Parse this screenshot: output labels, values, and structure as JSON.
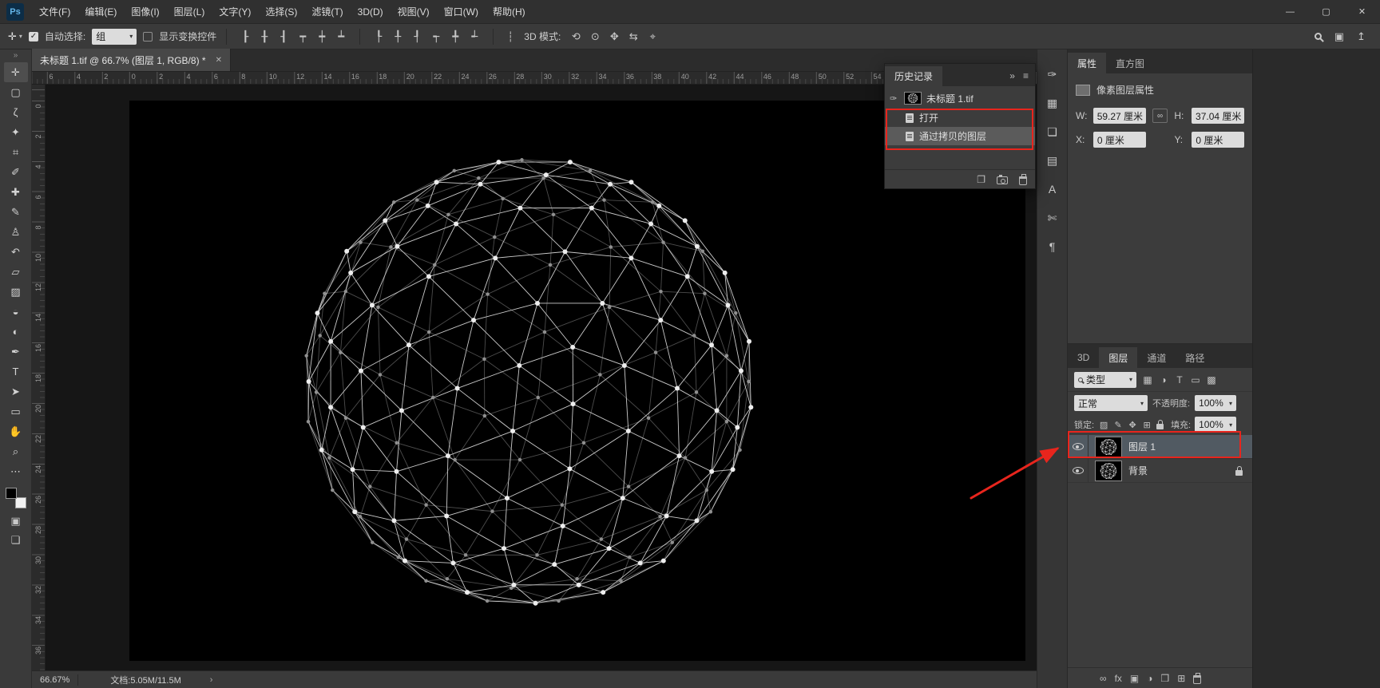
{
  "window": {
    "logo": "Ps",
    "controls": [
      {
        "name": "minimize-button",
        "glyph": "—"
      },
      {
        "name": "maximize-button",
        "glyph": "▢"
      },
      {
        "name": "close-button",
        "glyph": "✕"
      }
    ]
  },
  "menubar": {
    "items": [
      "文件(F)",
      "编辑(E)",
      "图像(I)",
      "图层(L)",
      "文字(Y)",
      "选择(S)",
      "滤镜(T)",
      "3D(D)",
      "视图(V)",
      "窗口(W)",
      "帮助(H)"
    ]
  },
  "optionsbar": {
    "active_tool_glyph": "✛",
    "auto_select_label": "自动选择:",
    "auto_select_value": "组",
    "show_transform_label": "显示变换控件",
    "mode_label": "3D 模式:",
    "align_icons": [
      {
        "name": "align-left-icon",
        "glyph": "┠"
      },
      {
        "name": "align-center-horizontal-icon",
        "glyph": "╂"
      },
      {
        "name": "align-right-icon",
        "glyph": "┨"
      },
      {
        "name": "align-top-icon",
        "glyph": "┯"
      },
      {
        "name": "align-middle-vertical-icon",
        "glyph": "┿"
      },
      {
        "name": "align-bottom-icon",
        "glyph": "┷"
      }
    ],
    "distribute_icons": [
      {
        "name": "distribute-top-icon",
        "glyph": "┞"
      },
      {
        "name": "distribute-vertical-center-icon",
        "glyph": "╀"
      },
      {
        "name": "distribute-bottom-icon",
        "glyph": "┦"
      },
      {
        "name": "distribute-left-icon",
        "glyph": "┭"
      },
      {
        "name": "distribute-horizontal-center-icon",
        "glyph": "╇"
      },
      {
        "name": "distribute-right-icon",
        "glyph": "┵"
      }
    ],
    "spacing_icon_glyph": "┆",
    "mode_icons": [
      {
        "name": "3d-orbit-icon",
        "glyph": "⟲"
      },
      {
        "name": "3d-roll-icon",
        "glyph": "⊙"
      },
      {
        "name": "3d-pan-icon",
        "glyph": "✥"
      },
      {
        "name": "3d-slide-icon",
        "glyph": "⇆"
      },
      {
        "name": "3d-zoom-icon",
        "glyph": "⌖"
      }
    ],
    "right_icons": [
      {
        "name": "workspace-icon",
        "glyph": "▣"
      },
      {
        "name": "share-icon",
        "glyph": "↥"
      }
    ]
  },
  "tools": [
    {
      "name": "move-tool",
      "glyph": "✛",
      "active": true
    },
    {
      "name": "marquee-tool",
      "glyph": "▢"
    },
    {
      "name": "lasso-tool",
      "glyph": "ζ"
    },
    {
      "name": "quick-selection-tool",
      "glyph": "✦"
    },
    {
      "name": "crop-tool",
      "glyph": "⌗"
    },
    {
      "name": "eyedropper-tool",
      "glyph": "✐"
    },
    {
      "name": "healing-brush-tool",
      "glyph": "✚"
    },
    {
      "name": "brush-tool",
      "glyph": "✎"
    },
    {
      "name": "clone-stamp-tool",
      "glyph": "♙"
    },
    {
      "name": "history-brush-tool",
      "glyph": "↶"
    },
    {
      "name": "eraser-tool",
      "glyph": "▱"
    },
    {
      "name": "gradient-tool",
      "glyph": "▨"
    },
    {
      "name": "blur-tool",
      "glyph": "◒"
    },
    {
      "name": "dodge-tool",
      "glyph": "◐"
    },
    {
      "name": "pen-tool",
      "glyph": "✒"
    },
    {
      "name": "type-tool",
      "glyph": "T"
    },
    {
      "name": "path-selection-tool",
      "glyph": "➤"
    },
    {
      "name": "shape-tool",
      "glyph": "▭"
    },
    {
      "name": "hand-tool",
      "glyph": "✋"
    },
    {
      "name": "zoom-tool",
      "glyph": "⌕"
    },
    {
      "name": "edit-toolbar-button",
      "glyph": "⋯"
    }
  ],
  "toolbar_extras": {
    "collapse_glyph": "»",
    "quick_mask_glyph": "▣",
    "screen_mode_glyph": "❏"
  },
  "document": {
    "tab_title": "未标题 1.tif @ 66.7% (图层 1, RGB/8) *",
    "close_glyph": "✕",
    "zoom_level": "66.67%",
    "doc_info": "文档:5.05M/11.5M",
    "chevron": "›"
  },
  "rulers": {
    "horizontal": [
      "6",
      "4",
      "2",
      "0",
      "2",
      "4",
      "6",
      "8",
      "10",
      "12",
      "14",
      "16",
      "18",
      "20",
      "22",
      "24",
      "26",
      "28",
      "30",
      "32",
      "34",
      "36",
      "38",
      "40",
      "42",
      "44",
      "46",
      "48",
      "50",
      "52",
      "54"
    ],
    "vertical": [
      "0",
      "2",
      "4",
      "6",
      "8",
      "10",
      "12",
      "14",
      "16",
      "18",
      "20",
      "22",
      "24",
      "26",
      "28",
      "30",
      "32",
      "34",
      "36"
    ]
  },
  "icon_dock": [
    {
      "name": "brush-settings-panel-icon",
      "glyph": "✑"
    },
    {
      "name": "swatches-panel-icon",
      "glyph": "▦"
    },
    {
      "name": "libraries-panel-icon",
      "glyph": "❏"
    },
    {
      "name": "adjustments-panel-icon",
      "glyph": "▤"
    },
    {
      "name": "character-panel-icon",
      "glyph": "A"
    },
    {
      "name": "glyphs-panel-icon",
      "glyph": "✄"
    },
    {
      "name": "paragraph-panel-icon",
      "glyph": "¶"
    }
  ],
  "history": {
    "title": "历史记录",
    "collapse_glyph": "»",
    "menu_glyph": "≡",
    "snapshot_label": "未标题 1.tif",
    "steps": [
      {
        "label": "打开"
      },
      {
        "label": "通过拷贝的图层",
        "selected": true
      }
    ]
  },
  "properties": {
    "tabs": [
      "属性",
      "直方图"
    ],
    "subtitle": "像素图层属性",
    "w_label": "W:",
    "w_value": "59.27 厘米",
    "h_label": "H:",
    "h_value": "37.04 厘米",
    "x_label": "X:",
    "x_value": "0 厘米",
    "y_label": "Y:",
    "y_value": "0 厘米"
  },
  "layers": {
    "tabs": [
      "3D",
      "图层",
      "通道",
      "路径"
    ],
    "filter_prefix": "类型",
    "filter_icons": [
      {
        "name": "filter-pixel-layers-icon",
        "glyph": "▦"
      },
      {
        "name": "filter-adjustment-layers-icon",
        "glyph": "◑"
      },
      {
        "name": "filter-type-layers-icon",
        "glyph": "T"
      },
      {
        "name": "filter-shape-layers-icon",
        "glyph": "▭"
      },
      {
        "name": "filter-smart-objects-icon",
        "glyph": "▩"
      }
    ],
    "blend_mode": "正常",
    "opacity_label": "不透明度:",
    "opacity_value": "100%",
    "lock_label": "锁定:",
    "lock_icons": [
      {
        "name": "lock-transparency-icon",
        "glyph": "▨"
      },
      {
        "name": "lock-pixels-icon",
        "glyph": "✎"
      },
      {
        "name": "lock-position-icon",
        "glyph": "✥"
      },
      {
        "name": "lock-artboard-icon",
        "glyph": "⊞"
      }
    ],
    "fill_label": "填充:",
    "fill_value": "100%",
    "rows": [
      {
        "name": "图层 1",
        "selected": true
      },
      {
        "name": "背景",
        "locked": true
      }
    ],
    "footer_icons": [
      {
        "name": "link-layers-icon",
        "glyph": "∞"
      },
      {
        "name": "layer-effects-icon",
        "glyph": "fx"
      },
      {
        "name": "add-layer-mask-icon",
        "glyph": "▣"
      },
      {
        "name": "new-adjustment-layer-icon",
        "glyph": "◑"
      },
      {
        "name": "new-group-icon",
        "glyph": "❒"
      },
      {
        "name": "new-layer-icon",
        "glyph": "⊞"
      }
    ]
  },
  "annotation_color": "#e8251d"
}
